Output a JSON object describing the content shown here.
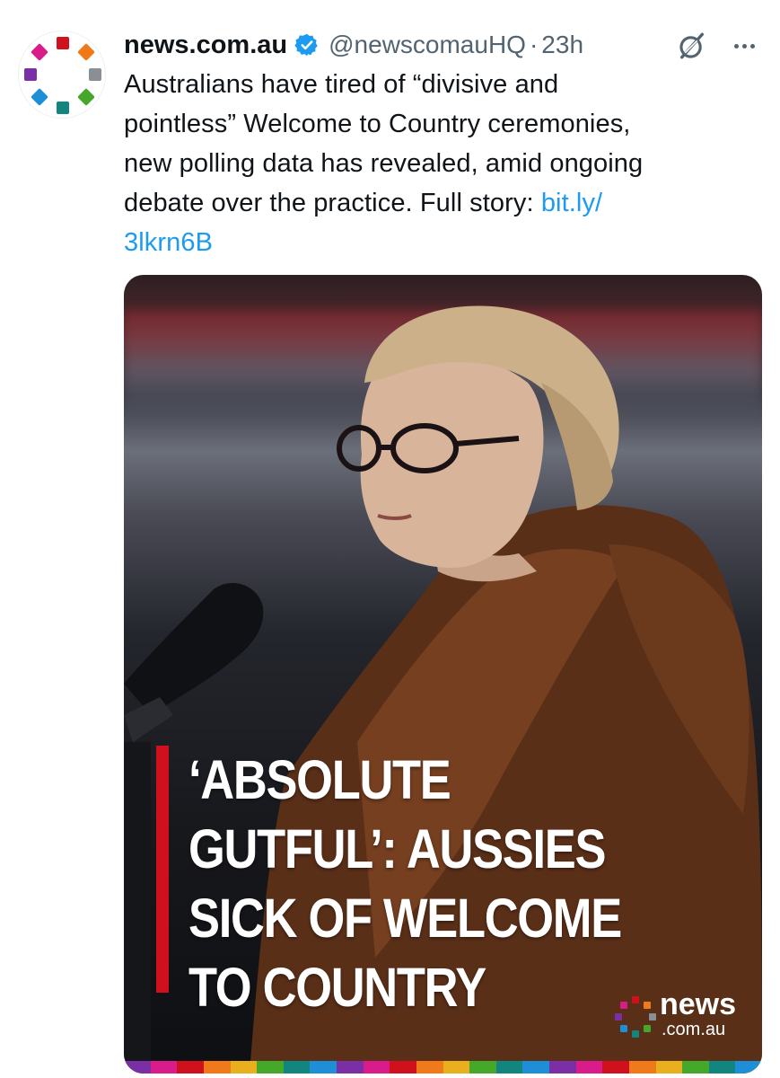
{
  "tweet": {
    "display_name": "news.com.au",
    "handle": "@newscomauHQ",
    "separator": "·",
    "time": "23h",
    "text_lines": [
      "Australians have tired of “divisive and",
      "pointless” Welcome to Country ceremonies,",
      "new polling data has revealed, amid ongoing",
      "debate over the practice. Full story: "
    ],
    "link_part1": "bit.ly/",
    "link_part2": "3lkrn6B"
  },
  "media": {
    "headline_lines": [
      "‘ABSOLUTE",
      "GUTFUL’: AUSSIES",
      "SICK OF WELCOME",
      "TO COUNTRY"
    ],
    "logo_word": "news",
    "logo_sub": ".com.au"
  },
  "colors": {
    "link": "#1d9bf0",
    "verified": "#1d9bf0",
    "muted": "#536471",
    "accent_red": "#d0101c"
  },
  "icons": {
    "verified": "verified-badge-icon",
    "grok": "grok-icon",
    "more": "more-dots-icon"
  }
}
